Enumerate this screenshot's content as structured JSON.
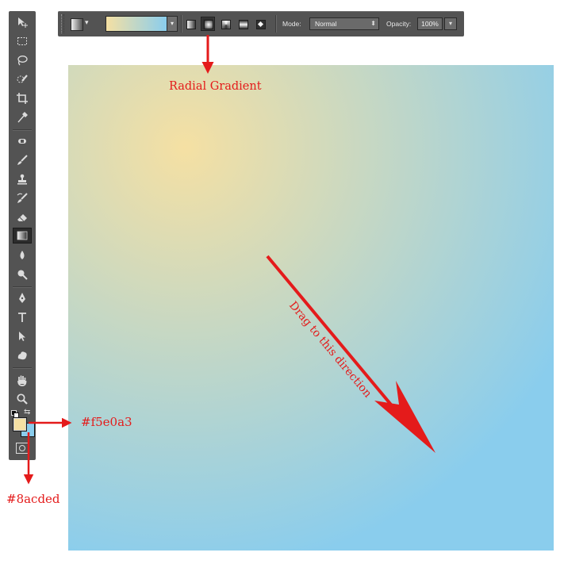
{
  "options_bar": {
    "gradient_colors": [
      "#f5e0a3",
      "#8acded"
    ],
    "gradient_types": [
      {
        "name": "linear",
        "active": false
      },
      {
        "name": "radial",
        "active": true
      },
      {
        "name": "angle",
        "active": false
      },
      {
        "name": "reflected",
        "active": false
      },
      {
        "name": "diamond",
        "active": false
      }
    ],
    "mode_label": "Mode:",
    "mode_value": "Normal",
    "opacity_label": "Opacity:",
    "opacity_value": "100%"
  },
  "toolbar": {
    "tools": [
      "move",
      "marquee",
      "lasso",
      "quick-selection",
      "crop",
      "eyedropper",
      "spot-healing",
      "brush",
      "clone-stamp",
      "history-brush",
      "eraser",
      "gradient",
      "blur",
      "dodge",
      "pen",
      "type",
      "path-selection",
      "shape",
      "hand",
      "zoom"
    ],
    "active_tool": "gradient",
    "foreground_color": "#f5e0a3",
    "background_color": "#8acded"
  },
  "canvas": {
    "gradient_start_color": "#f5e0a3",
    "gradient_end_color": "#8acded"
  },
  "annotations": {
    "radial_label": "Radial Gradient",
    "drag_label": "Drag to this direction",
    "foreground_hex": "#f5e0a3",
    "background_hex": "#8acded",
    "arrow_color": "#e41b1b"
  }
}
